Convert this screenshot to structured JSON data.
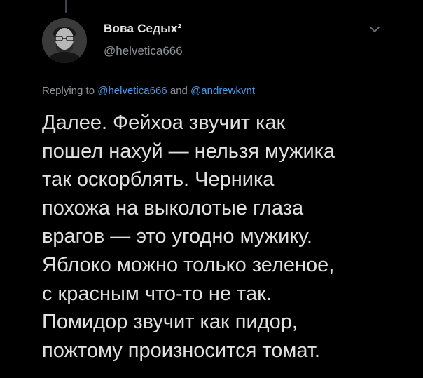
{
  "author": {
    "display_name": "Вова Седых²",
    "handle": "@helvetica666",
    "avatar_icon": "person-avatar-icon",
    "menu_icon": "chevron-down-icon"
  },
  "reply": {
    "prefix": "Replying to ",
    "mention_1": "@helvetica666",
    "joiner": " and ",
    "mention_2": "@andrewkvnt"
  },
  "tweet": {
    "lines": [
      "Далее. Фейхоа звучит как",
      "пошел нахуй — нельзя мужика",
      "так оскорблять. Черника",
      "похожа на выколотые глаза",
      "врагов — это угодно мужику.",
      "Яблоко можно только зеленое,",
      "с красным что-то не так.",
      "Помидор звучит как пидор,",
      "пожтому произносится томат."
    ]
  },
  "colors": {
    "background": "#000000",
    "text": "#e0e0e0",
    "secondary": "#8b9298",
    "link": "#4a99e9"
  }
}
